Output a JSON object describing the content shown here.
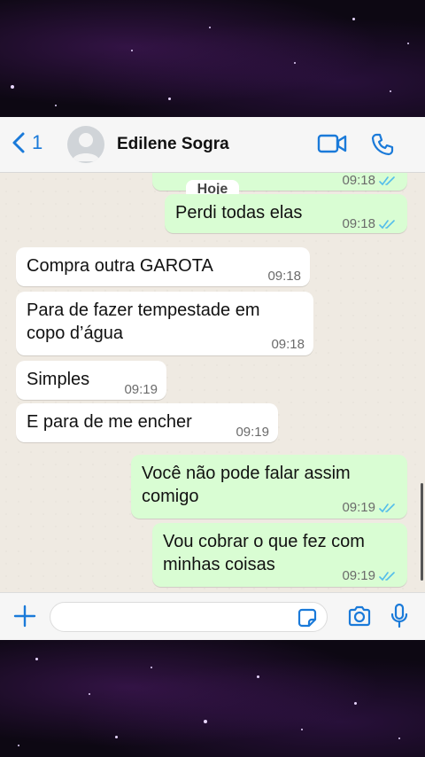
{
  "header": {
    "back_count": "1",
    "contact_name": "Edilene Sogra"
  },
  "chat": {
    "date_separator": "Hoje",
    "messages": [
      {
        "direction": "out",
        "text": "",
        "time": "09:18",
        "status": "read"
      },
      {
        "direction": "out",
        "text": "Perdi todas elas",
        "time": "09:18",
        "status": "read"
      },
      {
        "direction": "in",
        "text": "Compra outra GAROTA",
        "time": "09:18"
      },
      {
        "direction": "in",
        "text": "Para de fazer tempestade em copo d’água",
        "time": "09:18"
      },
      {
        "direction": "in",
        "text": "Simples",
        "time": "09:19"
      },
      {
        "direction": "in",
        "text": "E para de me encher",
        "time": "09:19"
      },
      {
        "direction": "out",
        "text": "Você não pode falar assim comigo",
        "time": "09:19",
        "status": "read"
      },
      {
        "direction": "out",
        "text": "Vou cobrar o que fez com minhas coisas",
        "time": "09:19",
        "status": "read"
      }
    ]
  },
  "composer": {
    "value": ""
  },
  "colors": {
    "accent": "#1a7ad9",
    "outgoing_bubble": "#d9fdd3",
    "incoming_bubble": "#ffffff",
    "read_ticks": "#53bdeb"
  }
}
